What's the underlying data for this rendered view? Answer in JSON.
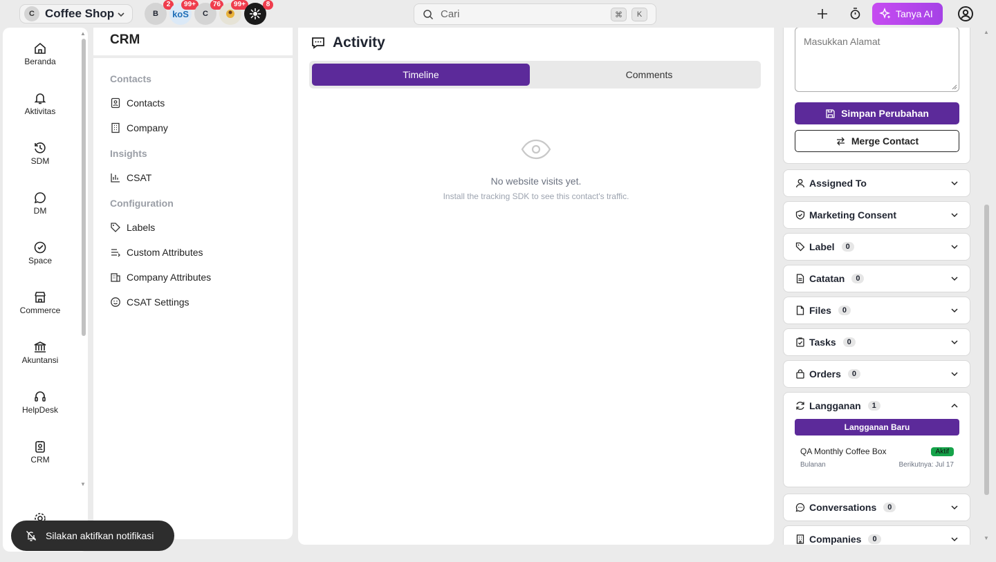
{
  "workspace": {
    "initial": "C",
    "name": "Coffee Shop"
  },
  "workspace_avatars": [
    {
      "label": "B",
      "badge": "2",
      "bg": "#d4d4d4"
    },
    {
      "label": "koS",
      "badge": "99+",
      "bg": "#dbe9f7"
    },
    {
      "label": "C",
      "badge": "76",
      "bg": "#d4d4d4"
    },
    {
      "label": "",
      "badge": "99+",
      "bg": "#e6e3d6"
    },
    {
      "label": "",
      "badge": "8",
      "bg": "#1a1a1a"
    }
  ],
  "search": {
    "placeholder": "Cari",
    "kbd1": "⌘",
    "kbd2": "K"
  },
  "ai_button": "Tanya AI",
  "nav": [
    {
      "label": "Beranda",
      "icon": "home-icon"
    },
    {
      "label": "Aktivitas",
      "icon": "bell-icon"
    },
    {
      "label": "SDM",
      "icon": "history-icon"
    },
    {
      "label": "DM",
      "icon": "chat-icon"
    },
    {
      "label": "Space",
      "icon": "check-circle-icon"
    },
    {
      "label": "Commerce",
      "icon": "store-icon"
    },
    {
      "label": "Akuntansi",
      "icon": "bank-icon"
    },
    {
      "label": "HelpDesk",
      "icon": "headset-icon"
    },
    {
      "label": "CRM",
      "icon": "contact-card-icon"
    }
  ],
  "crm": {
    "title": "CRM",
    "sections": [
      {
        "heading": "Contacts",
        "items": [
          "Contacts",
          "Company"
        ]
      },
      {
        "heading": "Insights",
        "items": [
          "CSAT"
        ]
      },
      {
        "heading": "Configuration",
        "items": [
          "Labels",
          "Custom Attributes",
          "Company Attributes",
          "CSAT Settings"
        ]
      }
    ]
  },
  "activity": {
    "title": "Activity",
    "tabs": [
      "Timeline",
      "Comments"
    ],
    "empty_title": "No website visits yet.",
    "empty_sub": "Install the tracking SDK to see this contact's traffic."
  },
  "details": {
    "address_placeholder": "Masukkan Alamat",
    "save_label": "Simpan Perubahan",
    "merge_label": "Merge Contact",
    "panels": [
      {
        "label": "Assigned To",
        "count": null
      },
      {
        "label": "Marketing Consent",
        "count": null
      },
      {
        "label": "Label",
        "count": "0"
      },
      {
        "label": "Catatan",
        "count": "0"
      },
      {
        "label": "Files",
        "count": "0"
      },
      {
        "label": "Tasks",
        "count": "0"
      },
      {
        "label": "Orders",
        "count": "0"
      }
    ],
    "subscription": {
      "label": "Langganan",
      "count": "1",
      "new_label": "Langganan Baru",
      "plan": "QA Monthly Coffee Box",
      "status": "Aktif",
      "interval": "Bulanan",
      "next": "Berikutnya: Jul 17"
    },
    "panels_after": [
      {
        "label": "Conversations",
        "count": "0"
      },
      {
        "label": "Companies",
        "count": "0"
      }
    ]
  },
  "toast": "Silakan aktifkan notifikasi",
  "colors": {
    "primary": "#5c2a9a",
    "ai": "#b646ec",
    "badge": "#ef3d4d",
    "active": "#16a34a"
  }
}
